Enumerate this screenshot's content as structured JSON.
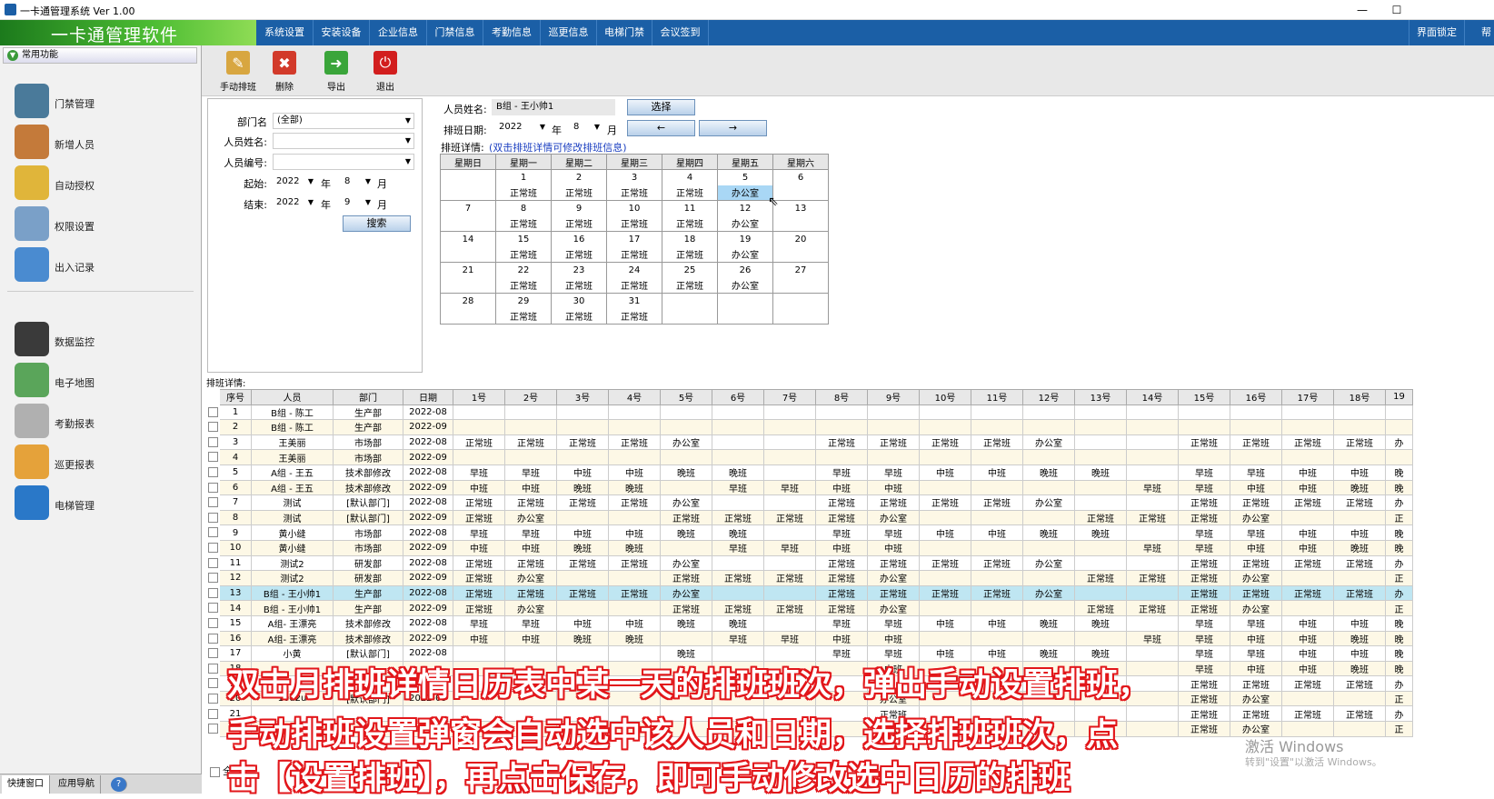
{
  "window": {
    "title": "一卡通管理系统  Ver 1.00",
    "min": "—",
    "max": "☐"
  },
  "app": {
    "brand": "一卡通管理软件"
  },
  "menu": [
    "系统设置",
    "安装设备",
    "企业信息",
    "门禁信息",
    "考勤信息",
    "巡更信息",
    "电梯门禁",
    "会议签到"
  ],
  "menu_right": [
    "界面锁定",
    "帮"
  ],
  "sidebar": {
    "header": "常用功能",
    "items": [
      "门禁管理",
      "新增人员",
      "自动授权",
      "权限设置",
      "出入记录",
      "数据监控",
      "电子地图",
      "考勤报表",
      "巡更报表",
      "电梯管理"
    ],
    "icon_colors": [
      "#4a7a9a",
      "#c47a3a",
      "#e0b53a",
      "#7aa0c8",
      "#4a8bd0",
      "#3a3a3a",
      "#5aa55a",
      "#b0b0b0",
      "#e5a23a",
      "#2a78c8"
    ]
  },
  "bottom_tabs": [
    "快捷窗口",
    "应用导航",
    "?"
  ],
  "toolbar": {
    "buttons": [
      "手动排班",
      "删除",
      "导出",
      "退出"
    ],
    "icons": [
      "✎",
      "✖",
      "➜",
      "⏻"
    ],
    "colors": [
      "#d8a640",
      "#d23a2a",
      "#3aa53a",
      "#d21e1e"
    ]
  },
  "filter": {
    "dept_label": "部门名",
    "dept_value": "(全部)",
    "name_label": "人员姓名:",
    "id_label": "人员编号:",
    "start_label": "起始:",
    "end_label": "结束:",
    "start_year": "2022",
    "start_month": "8",
    "end_year": "2022",
    "end_month": "9",
    "year_unit": "年",
    "month_unit": "月",
    "search": "搜索"
  },
  "person": {
    "label": "人员姓名:",
    "value": "B组 - 王小帅1",
    "select": "选择",
    "date_label": "排班日期:",
    "year": "2022",
    "year_unit": "年",
    "month": "8",
    "month_unit": "月",
    "prev": "←",
    "next": "→",
    "detail_label": "排班详情:",
    "detail_hint": "(双击排班详情可修改排班信息)"
  },
  "calendar": {
    "headers": [
      "星期日",
      "星期一",
      "星期二",
      "星期三",
      "星期四",
      "星期五",
      "星期六"
    ],
    "weeks": [
      {
        "days": [
          "",
          "1",
          "2",
          "3",
          "4",
          "5",
          "6"
        ],
        "shifts": [
          "",
          "正常班",
          "正常班",
          "正常班",
          "正常班",
          "办公室",
          ""
        ]
      },
      {
        "days": [
          "7",
          "8",
          "9",
          "10",
          "11",
          "12",
          "13"
        ],
        "shifts": [
          "",
          "正常班",
          "正常班",
          "正常班",
          "正常班",
          "办公室",
          ""
        ]
      },
      {
        "days": [
          "14",
          "15",
          "16",
          "17",
          "18",
          "19",
          "20"
        ],
        "shifts": [
          "",
          "正常班",
          "正常班",
          "正常班",
          "正常班",
          "办公室",
          ""
        ]
      },
      {
        "days": [
          "21",
          "22",
          "23",
          "24",
          "25",
          "26",
          "27"
        ],
        "shifts": [
          "",
          "正常班",
          "正常班",
          "正常班",
          "正常班",
          "办公室",
          ""
        ]
      },
      {
        "days": [
          "28",
          "29",
          "30",
          "31",
          "",
          "",
          ""
        ],
        "shifts": [
          "",
          "正常班",
          "正常班",
          "正常班",
          "",
          "",
          ""
        ]
      }
    ]
  },
  "grid": {
    "label": "排班详情:",
    "columns": [
      "序号",
      "人员",
      "部门",
      "日期",
      "1号",
      "2号",
      "3号",
      "4号",
      "5号",
      "6号",
      "7号",
      "8号",
      "9号",
      "10号",
      "11号",
      "12号",
      "13号",
      "14号",
      "15号",
      "16号",
      "17号",
      "18号",
      "19"
    ],
    "rows": [
      [
        "1",
        "B组 - 陈工",
        "生产部",
        "2022-08",
        "",
        "",
        "",
        "",
        "",
        "",
        "",
        "",
        "",
        "",
        "",
        "",
        "",
        "",
        "",
        "",
        "",
        "",
        ""
      ],
      [
        "2",
        "B组 - 陈工",
        "生产部",
        "2022-09",
        "",
        "",
        "",
        "",
        "",
        "",
        "",
        "",
        "",
        "",
        "",
        "",
        "",
        "",
        "",
        "",
        "",
        "",
        ""
      ],
      [
        "3",
        "王美丽",
        "市场部",
        "2022-08",
        "正常班",
        "正常班",
        "正常班",
        "正常班",
        "办公室",
        "",
        "",
        "正常班",
        "正常班",
        "正常班",
        "正常班",
        "办公室",
        "",
        "",
        "正常班",
        "正常班",
        "正常班",
        "正常班",
        "办"
      ],
      [
        "4",
        "王美丽",
        "市场部",
        "2022-09",
        "",
        "",
        "",
        "",
        "",
        "",
        "",
        "",
        "",
        "",
        "",
        "",
        "",
        "",
        "",
        "",
        "",
        "",
        ""
      ],
      [
        "5",
        "A组 - 王五",
        "技术部修改",
        "2022-08",
        "早班",
        "早班",
        "中班",
        "中班",
        "晚班",
        "晚班",
        "",
        "早班",
        "早班",
        "中班",
        "中班",
        "晚班",
        "晚班",
        "",
        "早班",
        "早班",
        "中班",
        "中班",
        "晚"
      ],
      [
        "6",
        "A组 - 王五",
        "技术部修改",
        "2022-09",
        "中班",
        "中班",
        "晚班",
        "晚班",
        "",
        "早班",
        "早班",
        "中班",
        "中班",
        "",
        "",
        "",
        "",
        "早班",
        "早班",
        "中班",
        "中班",
        "晚班",
        "晚"
      ],
      [
        "7",
        "测试",
        "[默认部门]",
        "2022-08",
        "正常班",
        "正常班",
        "正常班",
        "正常班",
        "办公室",
        "",
        "",
        "正常班",
        "正常班",
        "正常班",
        "正常班",
        "办公室",
        "",
        "",
        "正常班",
        "正常班",
        "正常班",
        "正常班",
        "办"
      ],
      [
        "8",
        "测试",
        "[默认部门]",
        "2022-09",
        "正常班",
        "办公室",
        "",
        "",
        "正常班",
        "正常班",
        "正常班",
        "正常班",
        "办公室",
        "",
        "",
        "",
        "正常班",
        "正常班",
        "正常班",
        "办公室",
        "",
        "",
        "正"
      ],
      [
        "9",
        "黄小缝",
        "市场部",
        "2022-08",
        "早班",
        "早班",
        "中班",
        "中班",
        "晚班",
        "晚班",
        "",
        "早班",
        "早班",
        "中班",
        "中班",
        "晚班",
        "晚班",
        "",
        "早班",
        "早班",
        "中班",
        "中班",
        "晚"
      ],
      [
        "10",
        "黄小缝",
        "市场部",
        "2022-09",
        "中班",
        "中班",
        "晚班",
        "晚班",
        "",
        "早班",
        "早班",
        "中班",
        "中班",
        "",
        "",
        "",
        "",
        "早班",
        "早班",
        "中班",
        "中班",
        "晚班",
        "晚"
      ],
      [
        "11",
        "测试2",
        "研发部",
        "2022-08",
        "正常班",
        "正常班",
        "正常班",
        "正常班",
        "办公室",
        "",
        "",
        "正常班",
        "正常班",
        "正常班",
        "正常班",
        "办公室",
        "",
        "",
        "正常班",
        "正常班",
        "正常班",
        "正常班",
        "办"
      ],
      [
        "12",
        "测试2",
        "研发部",
        "2022-09",
        "正常班",
        "办公室",
        "",
        "",
        "正常班",
        "正常班",
        "正常班",
        "正常班",
        "办公室",
        "",
        "",
        "",
        "正常班",
        "正常班",
        "正常班",
        "办公室",
        "",
        "",
        "正"
      ],
      [
        "13",
        "B组 - 王小帅1",
        "生产部",
        "2022-08",
        "正常班",
        "正常班",
        "正常班",
        "正常班",
        "办公室",
        "",
        "",
        "正常班",
        "正常班",
        "正常班",
        "正常班",
        "办公室",
        "",
        "",
        "正常班",
        "正常班",
        "正常班",
        "正常班",
        "办"
      ],
      [
        "14",
        "B组 - 王小帅1",
        "生产部",
        "2022-09",
        "正常班",
        "办公室",
        "",
        "",
        "正常班",
        "正常班",
        "正常班",
        "正常班",
        "办公室",
        "",
        "",
        "",
        "正常班",
        "正常班",
        "正常班",
        "办公室",
        "",
        "",
        "正"
      ],
      [
        "15",
        "A组- 王漂亮",
        "技术部修改",
        "2022-08",
        "早班",
        "早班",
        "中班",
        "中班",
        "晚班",
        "晚班",
        "",
        "早班",
        "早班",
        "中班",
        "中班",
        "晚班",
        "晚班",
        "",
        "早班",
        "早班",
        "中班",
        "中班",
        "晚"
      ],
      [
        "16",
        "A组- 王漂亮",
        "技术部修改",
        "2022-09",
        "中班",
        "中班",
        "晚班",
        "晚班",
        "",
        "早班",
        "早班",
        "中班",
        "中班",
        "",
        "",
        "",
        "",
        "早班",
        "早班",
        "中班",
        "中班",
        "晚班",
        "晚"
      ],
      [
        "17",
        "小黄",
        "[默认部门]",
        "2022-08",
        "",
        "",
        "",
        "",
        "晚班",
        "",
        "",
        "早班",
        "早班",
        "中班",
        "中班",
        "晚班",
        "晚班",
        "",
        "早班",
        "早班",
        "中班",
        "中班",
        "晚"
      ],
      [
        "18",
        "",
        "",
        "",
        "",
        "",
        "",
        "",
        "",
        "",
        "",
        "",
        "中班",
        "",
        "",
        "",
        "",
        "",
        "早班",
        "中班",
        "中班",
        "晚班",
        "晚"
      ],
      [
        "19",
        "",
        "",
        "",
        "",
        "",
        "",
        "",
        "",
        "",
        "",
        "",
        "",
        "",
        "",
        "",
        "",
        "",
        "正常班",
        "正常班",
        "正常班",
        "正常班",
        "办"
      ],
      [
        "20",
        "10u2u",
        "[默认部门]",
        "2022-09",
        "",
        "",
        "",
        "",
        "",
        "",
        "",
        "",
        "办公室",
        "",
        "",
        "",
        "",
        "",
        "正常班",
        "办公室",
        "",
        "",
        "正"
      ],
      [
        "21",
        "",
        "",
        "",
        "",
        "",
        "",
        "",
        "",
        "",
        "",
        "",
        "正常班",
        "",
        "",
        "",
        "",
        "",
        "正常班",
        "正常班",
        "正常班",
        "正常班",
        "办"
      ],
      [
        "22",
        "",
        "",
        "",
        "",
        "",
        "",
        "",
        "",
        "",
        "",
        "",
        "办公室",
        "",
        "",
        "",
        "",
        "",
        "正常班",
        "办公室",
        "",
        "",
        "正"
      ]
    ],
    "selected_row": 12
  },
  "caption": {
    "line1": "双击月排班详情日历表中某一天的排班班次，弹出手动设置排班，",
    "line2": "手动排班设置弹窗会自动选中该人员和日期，选择排班班次，点",
    "line3": "击【设置排班】，再点击保存，即可手动修改选中日历的排班"
  },
  "watermark": {
    "line1": "激活 Windows",
    "line2": "转到\"设置\"以激活 Windows。"
  },
  "footer": {
    "select_all": "全"
  }
}
